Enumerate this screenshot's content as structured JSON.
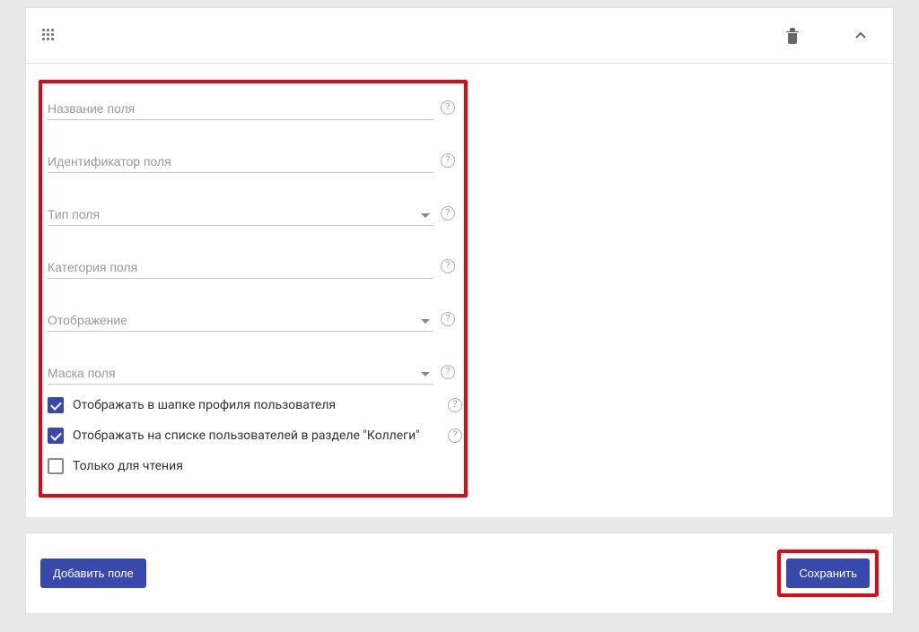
{
  "form": {
    "fields": [
      {
        "placeholder": "Название поля",
        "type": "text"
      },
      {
        "placeholder": "Идентификатор поля",
        "type": "text"
      },
      {
        "placeholder": "Тип поля",
        "type": "select"
      },
      {
        "placeholder": "Категория поля",
        "type": "text"
      },
      {
        "placeholder": "Отображение",
        "type": "select"
      },
      {
        "placeholder": "Маска поля",
        "type": "select"
      }
    ],
    "checkboxes": [
      {
        "label": "Отображать в шапке профиля пользователя",
        "checked": true
      },
      {
        "label": "Отображать на списке пользователей в разделе \"Коллеги\"",
        "checked": true
      },
      {
        "label": "Только для чтения",
        "checked": false
      }
    ]
  },
  "buttons": {
    "add": "Добавить поле",
    "save": "Сохранить"
  }
}
